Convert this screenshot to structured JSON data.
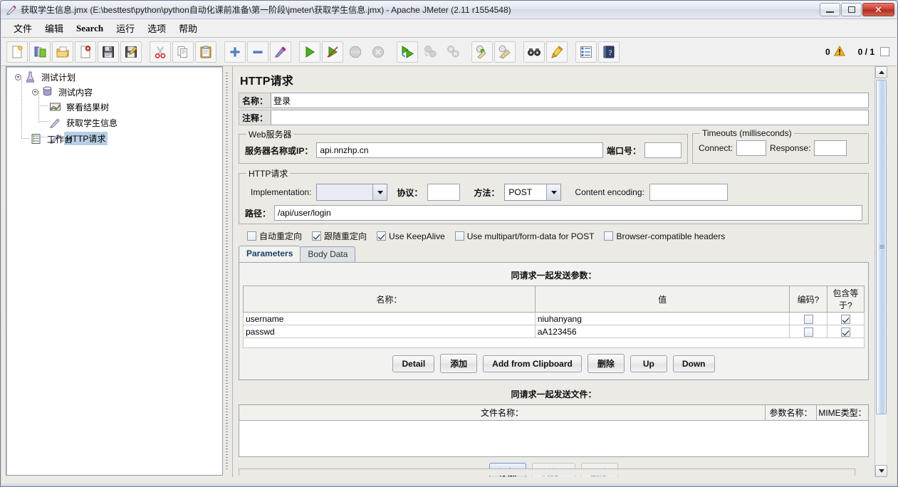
{
  "window": {
    "title": "获取学生信息.jmx (E:\\besttest\\python\\python自动化课前准备\\第一阶段\\jmeter\\获取学生信息.jmx) - Apache JMeter (2.11 r1554548)",
    "minimize_label": "minimize",
    "maximize_label": "maximize",
    "close_label": "✕"
  },
  "menu": {
    "items": [
      {
        "label": "文件"
      },
      {
        "label": "编辑"
      },
      {
        "label": "Search"
      },
      {
        "label": "运行"
      },
      {
        "label": "选项"
      },
      {
        "label": "帮助"
      }
    ]
  },
  "toolbar": {
    "buttons": [
      {
        "name": "new-icon",
        "title": "新建"
      },
      {
        "name": "templates-icon",
        "title": "模板"
      },
      {
        "name": "open-icon",
        "title": "打开"
      },
      {
        "name": "close-file-icon",
        "title": "关闭"
      },
      {
        "name": "save-icon",
        "title": "保存"
      },
      {
        "name": "save-as-icon",
        "title": "另存为"
      },
      {
        "name": "cut-icon",
        "title": "剪切"
      },
      {
        "name": "copy-icon",
        "title": "复制"
      },
      {
        "name": "paste-icon",
        "title": "粘贴"
      },
      {
        "name": "expand-icon",
        "title": "展开"
      },
      {
        "name": "collapse-icon",
        "title": "折叠"
      },
      {
        "name": "toggle-icon",
        "title": "开关"
      },
      {
        "name": "start-icon",
        "title": "启动"
      },
      {
        "name": "start-no-pause-icon",
        "title": "无间隔启动"
      },
      {
        "name": "stop-icon",
        "title": "停止"
      },
      {
        "name": "shutdown-icon",
        "title": "关闭"
      },
      {
        "name": "remote-start-all-icon",
        "title": "远程启动所有"
      },
      {
        "name": "remote-stop-all-icon",
        "title": "远程停止所有"
      },
      {
        "name": "remote-shutdown-all-icon",
        "title": "远程关闭所有"
      },
      {
        "name": "clear-icon",
        "title": "清除"
      },
      {
        "name": "clear-all-icon",
        "title": "清除全部"
      },
      {
        "name": "search-icon",
        "title": "查找"
      },
      {
        "name": "reset-search-icon",
        "title": "重置查找"
      },
      {
        "name": "function-helper-icon",
        "title": "函数助手"
      },
      {
        "name": "help-icon",
        "title": "帮助"
      }
    ],
    "error_count": "0",
    "thread_count": "0 / 1"
  },
  "tree": {
    "nodes": [
      {
        "label": "测试计划",
        "icon": "test-plan-icon",
        "selected": false
      },
      {
        "label": "测试内容",
        "icon": "thread-group-icon",
        "selected": false
      },
      {
        "label": "察看结果树",
        "icon": "view-results-tree-icon",
        "selected": false
      },
      {
        "label": "获取学生信息",
        "icon": "http-sampler-icon",
        "selected": false
      },
      {
        "label": "HTTP请求",
        "icon": "http-sampler-icon",
        "selected": true
      },
      {
        "label": "工作台",
        "icon": "workbench-icon",
        "selected": false
      }
    ]
  },
  "main": {
    "title": "HTTP请求",
    "name_label": "名称：",
    "name_value": "登录",
    "comment_label": "注释：",
    "comment_value": "",
    "web_server": {
      "legend": "Web服务器",
      "server_label": "服务器名称或IP：",
      "server_value": "api.nnzhp.cn",
      "port_label": "端口号：",
      "port_value": ""
    },
    "timeouts": {
      "legend": "Timeouts (milliseconds)",
      "connect_label": "Connect:",
      "connect_value": "",
      "response_label": "Response:",
      "response_value": ""
    },
    "http_request": {
      "legend": "HTTP请求",
      "implementation_label": "Implementation:",
      "implementation_value": "",
      "protocol_label": "协议：",
      "protocol_value": "",
      "method_label": "方法：",
      "method_value": "POST",
      "content_encoding_label": "Content encoding:",
      "content_encoding_value": "",
      "path_label": "路径：",
      "path_value": "/api/user/login"
    },
    "options": [
      {
        "label": "自动重定向",
        "checked": false
      },
      {
        "label": "跟随重定向",
        "checked": true
      },
      {
        "label": "Use KeepAlive",
        "checked": true
      },
      {
        "label": "Use multipart/form-data for POST",
        "checked": false
      },
      {
        "label": "Browser-compatible headers",
        "checked": false
      }
    ],
    "tabs": [
      {
        "label": "Parameters",
        "active": true
      },
      {
        "label": "Body Data",
        "active": false
      }
    ],
    "params": {
      "section_title": "同请求一起发送参数：",
      "columns": [
        "名称：",
        "值",
        "编码?",
        "包含等于?"
      ],
      "rows": [
        {
          "name": "username",
          "value": "niuhanyang",
          "encode": false,
          "include_equals": true
        },
        {
          "name": "passwd",
          "value": "aA123456",
          "encode": false,
          "include_equals": true
        }
      ],
      "buttons": [
        {
          "label": "Detail",
          "state": "normal"
        },
        {
          "label": "添加",
          "state": "normal"
        },
        {
          "label": "Add from Clipboard",
          "state": "normal"
        },
        {
          "label": "删除",
          "state": "normal"
        },
        {
          "label": "Up",
          "state": "normal"
        },
        {
          "label": "Down",
          "state": "normal"
        }
      ]
    },
    "files": {
      "section_title": "同请求一起发送文件：",
      "columns": [
        "文件名称：",
        "参数名称：",
        "MIME类型："
      ],
      "rows": [],
      "buttons": [
        {
          "label": "添加",
          "state": "focused"
        },
        {
          "label": "浏览...",
          "state": "disabled"
        },
        {
          "label": "删除",
          "state": "disabled"
        }
      ]
    }
  }
}
